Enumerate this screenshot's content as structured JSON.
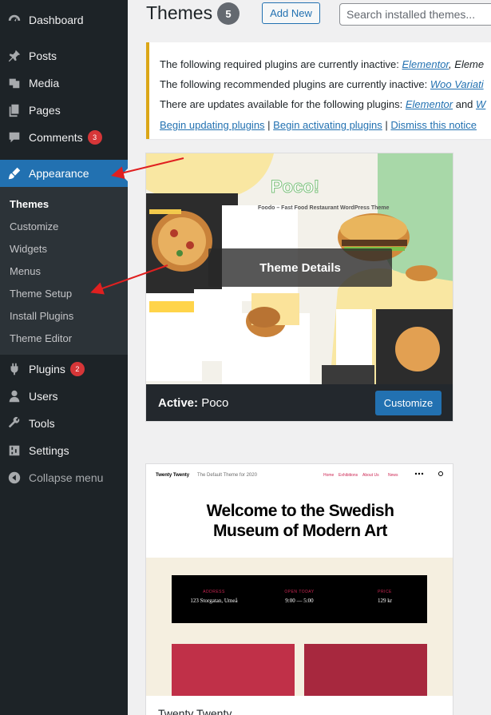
{
  "sidebar": {
    "items": [
      {
        "label": "Dashboard",
        "icon": "dashboard-icon"
      },
      {
        "label": "Posts",
        "icon": "pin-icon"
      },
      {
        "label": "Media",
        "icon": "media-icon"
      },
      {
        "label": "Pages",
        "icon": "pages-icon"
      },
      {
        "label": "Comments",
        "icon": "comments-icon",
        "badge": "3"
      },
      {
        "label": "Appearance",
        "icon": "brush-icon"
      },
      {
        "label": "Plugins",
        "icon": "plugin-icon",
        "badge": "2"
      },
      {
        "label": "Users",
        "icon": "users-icon"
      },
      {
        "label": "Tools",
        "icon": "wrench-icon"
      },
      {
        "label": "Settings",
        "icon": "settings-icon"
      },
      {
        "label": "Collapse menu",
        "icon": "collapse-icon"
      }
    ],
    "submenu": [
      "Themes",
      "Customize",
      "Widgets",
      "Menus",
      "Theme Setup",
      "Install Plugins",
      "Theme Editor"
    ]
  },
  "header": {
    "title": "Themes",
    "count": "5",
    "add_new": "Add New",
    "search_placeholder": "Search installed themes..."
  },
  "notice": {
    "line1_text": "The following required plugins are currently inactive: ",
    "line1_link": "Elementor",
    "line1_tail": ", Eleme",
    "line2_text": "The following recommended plugins are currently inactive: ",
    "line2_link": "Woo Variati",
    "line3_text": "There are updates available for the following plugins: ",
    "line3_link": "Elementor",
    "line3_and": " and ",
    "line3_tail": "W",
    "link_update": "Begin updating plugins",
    "link_activate": "Begin activating plugins",
    "link_dismiss": "Dismiss this notice",
    "separator": " | "
  },
  "themes": {
    "active": {
      "overlay": "Theme Details",
      "active_label": "Active:",
      "name": "Poco",
      "customize": "Customize",
      "shot": {
        "logo": "Poco!",
        "tagline": "Foodo – Fast Food Restaurant WordPress Theme"
      }
    },
    "second": {
      "name": "Twenty Twenty",
      "shot": {
        "site": "Twenty Twenty",
        "tagline": "The Default Theme for 2020",
        "menu": [
          "Home",
          "Exhibitions",
          "About Us",
          "News"
        ],
        "headline_1": "Welcome to the Swedish",
        "headline_2": "Museum of Modern Art",
        "address_label": "ADDRESS",
        "address_value": "123 Storgatan, Umeå",
        "open_label": "OPEN TODAY",
        "open_value": "9:00 — 5:00",
        "price_label": "PRICE",
        "price_value": "129 kr"
      }
    }
  },
  "colors": {
    "sidebar_bg": "#1d2327",
    "active_menu": "#2271b1",
    "badge": "#d63638",
    "notice_border": "#dba617",
    "annotation_arrow": "#e02020"
  }
}
